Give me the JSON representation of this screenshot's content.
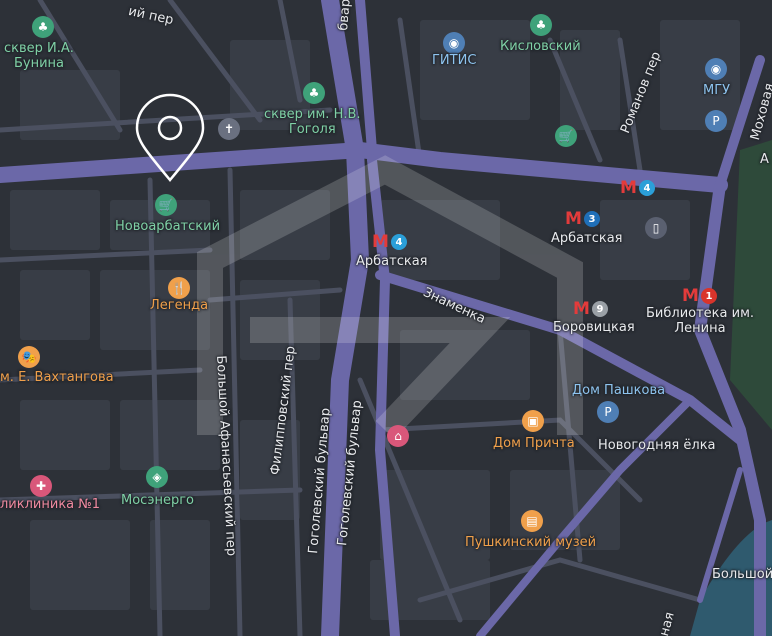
{
  "labels": {
    "bunin_square": "сквер И.А.\nБунина",
    "gogol_square": "сквер им. Н.В.\nГоголя",
    "gitis": "ГИТИС",
    "kislovsky": "Кисловский",
    "mgu": "МГУ",
    "novoarbatsky": "Новоарбатский",
    "legenda": "Легенда",
    "vakhtangov": "м. Е. Вахтангова",
    "mosenergo": "Мосэнерго",
    "polyclinic": "ликлиника №1",
    "arbatskaya_west": "Арбатская",
    "arbatskaya_east": "Арбатская",
    "borovitskaya": "Боровицкая",
    "library": "Библиотека им.\nЛенина",
    "pashkov": "Дом Пашкова",
    "dom_prichta": "Дом Причта",
    "new_year_tree": "Новогодняя ёлка",
    "pushkin_museum": "Пушкинский музей",
    "bolshoy": "Большой",
    "street_top": "ий пер",
    "street_boulevard_top": "бвар",
    "street_romanov": "Романов пер",
    "street_mokhovaya": "Моховая",
    "street_znamenka": "Знаменка",
    "street_bolshoy_afanasevsky": "Большой Афанасьевский пер",
    "street_filippovsky": "Филипповский пер",
    "street_gogolevsky_1": "Гоголевский бульвар",
    "street_gogolevsky_2": "Гоголевский бульвар",
    "street_naya": "ная",
    "edge_a": "А"
  },
  "metro_lines": {
    "arbatskaya_west": "4",
    "arbatskaya_east_top": "4",
    "arbatskaya_east": "3",
    "borovitskaya": "9",
    "library": "1"
  },
  "metro_symbol": "М",
  "colors": {
    "background": "#2d3138",
    "road_major": "#6b68a8",
    "road_minor": "#474c57",
    "orange_poi": "#f0a04b",
    "green_poi": "#3fa27a",
    "blue_poi": "#4f7fb5",
    "pink_poi": "#d9577a",
    "metro_red": "#e33b3b",
    "line_1": "#d9342b",
    "line_3": "#1f6fb8",
    "line_4": "#2b9fd8",
    "line_9": "#9aa0a6",
    "water": "#2f5a6e",
    "watermark": "#ffffff"
  }
}
